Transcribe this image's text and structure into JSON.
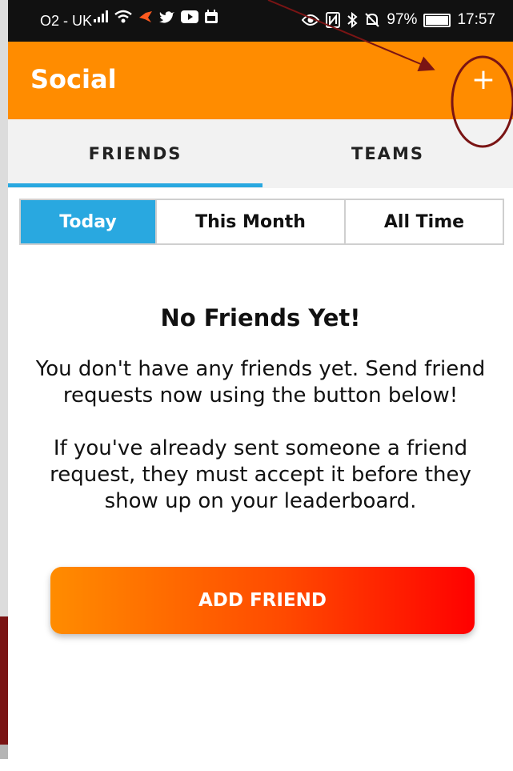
{
  "statusbar": {
    "carrier": "O2 - UK",
    "battery_text": "97%",
    "battery_level": 0.97,
    "time": "17:57",
    "icons": [
      "signal-icon",
      "wifi-icon",
      "bird-icon",
      "twitter-icon",
      "youtube-icon",
      "calendar-icon",
      "eye-icon",
      "nfc-icon",
      "bluetooth-icon",
      "mute-icon",
      "battery-icon"
    ]
  },
  "appbar": {
    "title": "Social",
    "add_icon": "+",
    "background": "#ff8c00"
  },
  "tabs": [
    {
      "label": "FRIENDS",
      "active": true
    },
    {
      "label": "TEAMS",
      "active": false
    }
  ],
  "periods": [
    {
      "label": "Today",
      "active": true
    },
    {
      "label": "This Month",
      "active": false
    },
    {
      "label": "All Time",
      "active": false
    }
  ],
  "empty_state": {
    "title": "No Friends Yet!",
    "message1": "You don't have any friends yet. Send friend requests now using the button below!",
    "message2": "If you've already sent someone a friend request, they must accept it before they show up on your leaderboard."
  },
  "add_friend_label": "ADD FRIEND",
  "colors": {
    "accent": "#ff8c00",
    "tab_active": "#29a8e0",
    "annotation": "#7a1414"
  }
}
